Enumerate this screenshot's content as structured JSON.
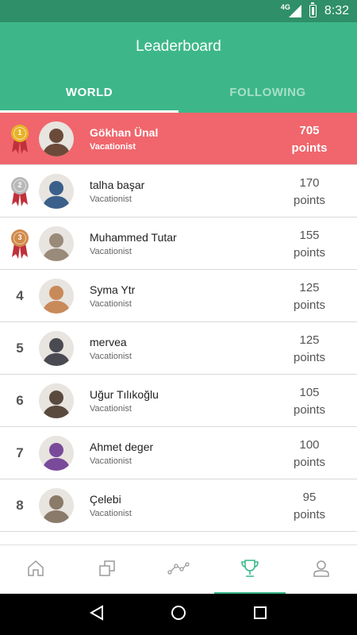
{
  "status_bar": {
    "network": "4G",
    "time": "8:32"
  },
  "header": {
    "title": "Leaderboard"
  },
  "tabs": [
    {
      "label": "WORLD",
      "active": true
    },
    {
      "label": "FOLLOWING",
      "active": false
    }
  ],
  "leaderboard": [
    {
      "rank": "1",
      "medal": "gold",
      "name": "Gökhan Ünal",
      "subtitle": "Vacationist",
      "points": "705",
      "points_label": "points",
      "highlighted": true,
      "avatar_color": "#6b4a3a"
    },
    {
      "rank": "2",
      "medal": "silver",
      "name": "talha başar",
      "subtitle": "Vacationist",
      "points": "170",
      "points_label": "points",
      "highlighted": false,
      "avatar_color": "#3a5f8a"
    },
    {
      "rank": "3",
      "medal": "bronze",
      "name": "Muhammed Tutar",
      "subtitle": "Vacationist",
      "points": "155",
      "points_label": "points",
      "highlighted": false,
      "avatar_color": "#9a8a7a"
    },
    {
      "rank": "4",
      "medal": "",
      "name": "Syma Ytr",
      "subtitle": "Vacationist",
      "points": "125",
      "points_label": "points",
      "highlighted": false,
      "avatar_color": "#c98a5a"
    },
    {
      "rank": "5",
      "medal": "",
      "name": "mervea",
      "subtitle": "Vacationist",
      "points": "125",
      "points_label": "points",
      "highlighted": false,
      "avatar_color": "#4a4a52"
    },
    {
      "rank": "6",
      "medal": "",
      "name": "Uğur Tılıkoğlu",
      "subtitle": "Vacationist",
      "points": "105",
      "points_label": "points",
      "highlighted": false,
      "avatar_color": "#5a4a3e"
    },
    {
      "rank": "7",
      "medal": "",
      "name": "Ahmet deger",
      "subtitle": "Vacationist",
      "points": "100",
      "points_label": "points",
      "highlighted": false,
      "avatar_color": "#7a4a9a"
    },
    {
      "rank": "8",
      "medal": "",
      "name": "Çelebi",
      "subtitle": "Vacationist",
      "points": "95",
      "points_label": "points",
      "highlighted": false,
      "avatar_color": "#8a7a6a"
    }
  ],
  "bottom_nav": [
    {
      "icon": "home-icon",
      "active": false
    },
    {
      "icon": "layers-icon",
      "active": false
    },
    {
      "icon": "route-icon",
      "active": false
    },
    {
      "icon": "trophy-icon",
      "active": true
    },
    {
      "icon": "profile-icon",
      "active": false
    }
  ],
  "colors": {
    "primary": "#3db78a",
    "status_bar": "#2f8f68",
    "highlight_row": "#f0666c",
    "gold": "#e8b228",
    "silver": "#b8b8b8",
    "bronze": "#d18a4a",
    "ribbon": "#c0303a"
  }
}
